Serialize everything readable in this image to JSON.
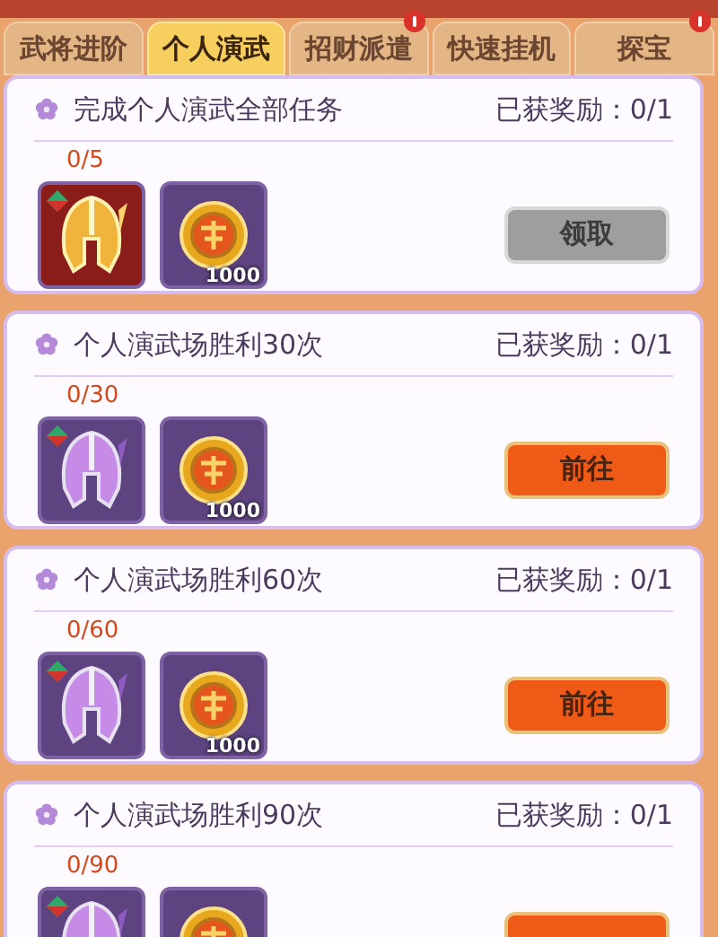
{
  "tabs": [
    {
      "label": "武将进阶",
      "selected": false,
      "alert": false
    },
    {
      "label": "个人演武",
      "selected": true,
      "alert": false
    },
    {
      "label": "招财派遣",
      "selected": false,
      "alert": true
    },
    {
      "label": "快速挂机",
      "selected": false,
      "alert": false
    },
    {
      "label": "探宝",
      "selected": false,
      "alert": true
    }
  ],
  "tasks": [
    {
      "title": "完成个人演武全部任务",
      "reward_status": "已获奖励：0/1",
      "progress": "0/5",
      "rewards": [
        {
          "kind": "helmet",
          "color": "#8a1c1a"
        },
        {
          "kind": "coin",
          "color": "#5d4480",
          "count": "1000"
        }
      ],
      "button": {
        "label": "领取",
        "disabled": true
      }
    },
    {
      "title": "个人演武场胜利30次",
      "reward_status": "已获奖励：0/1",
      "progress": "0/30",
      "rewards": [
        {
          "kind": "helmet",
          "color": "#5d4480"
        },
        {
          "kind": "coin",
          "color": "#5d4480",
          "count": "1000"
        }
      ],
      "button": {
        "label": "前往",
        "disabled": false
      }
    },
    {
      "title": "个人演武场胜利60次",
      "reward_status": "已获奖励：0/1",
      "progress": "0/60",
      "rewards": [
        {
          "kind": "helmet",
          "color": "#5d4480"
        },
        {
          "kind": "coin",
          "color": "#5d4480",
          "count": "1000"
        }
      ],
      "button": {
        "label": "前往",
        "disabled": false
      }
    },
    {
      "title": "个人演武场胜利90次",
      "reward_status": "已获奖励：0/1",
      "progress": "0/90",
      "rewards": [
        {
          "kind": "helmet",
          "color": "#5d4480"
        },
        {
          "kind": "coin",
          "color": "#5d4480"
        }
      ],
      "button": {
        "disabled": false
      }
    }
  ]
}
